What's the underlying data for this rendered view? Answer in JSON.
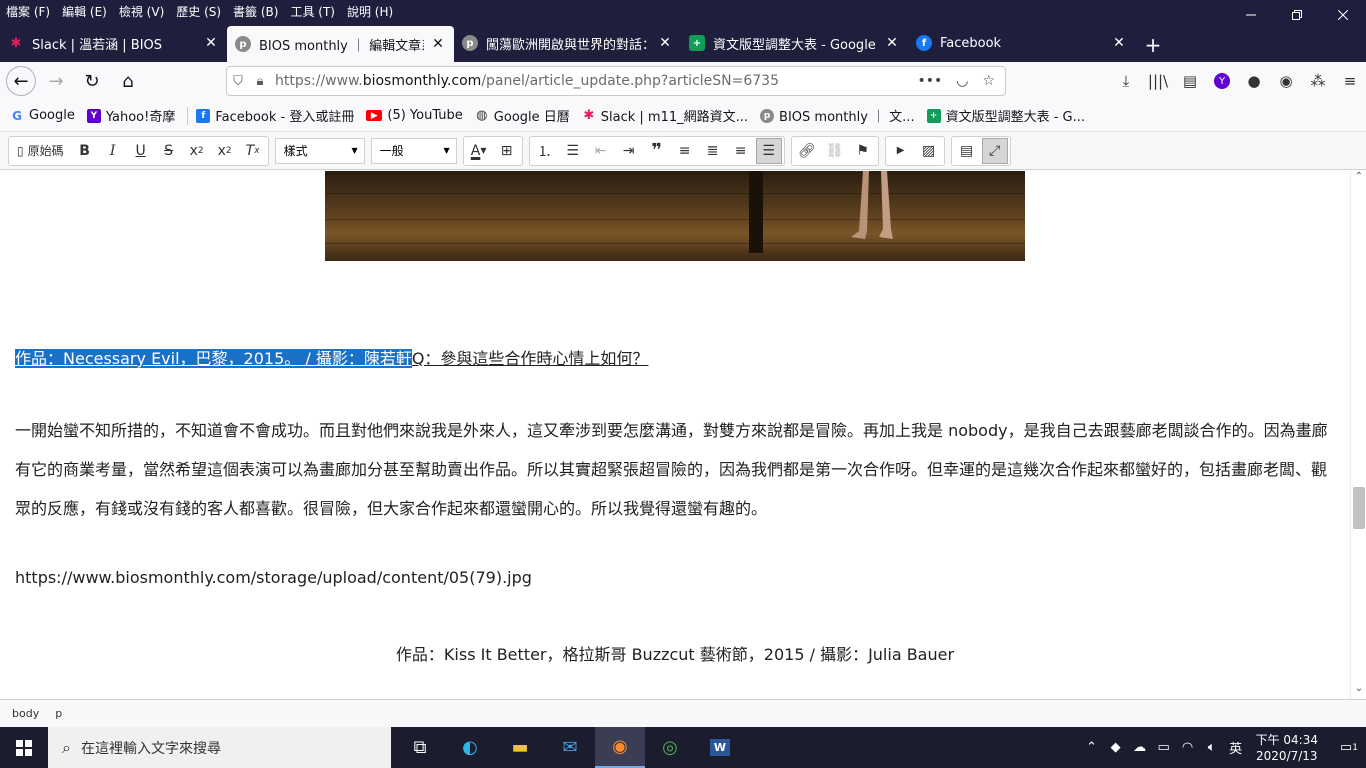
{
  "menu": [
    "檔案 (F)",
    "編輯 (E)",
    "檢視 (V)",
    "歷史 (S)",
    "書籤 (B)",
    "工具 (T)",
    "說明 (H)"
  ],
  "tabs": [
    {
      "label": "Slack | 溫若涵 | BIOS",
      "icon": "slack-icon",
      "active": false
    },
    {
      "label": "BIOS monthly ｜ 編輯文章系統",
      "icon": "bios-icon",
      "active": true
    },
    {
      "label": "闖蕩歐洲開啟與世界的對話：",
      "icon": "bios-icon",
      "active": false
    },
    {
      "label": "資文版型調整大表 - Google 試",
      "icon": "sheets-icon",
      "active": false
    },
    {
      "label": "Facebook",
      "icon": "facebook-icon",
      "active": false
    }
  ],
  "url": {
    "pre": "https://www.",
    "domain": "biosmonthly.com",
    "post": "/panel/article_update.php?articleSN=6735"
  },
  "bookmarks": [
    {
      "label": "Google",
      "icon": "google-icon"
    },
    {
      "label": "Yahoo!奇摩",
      "icon": "yahoo-icon"
    },
    {
      "label": "Facebook - 登入或註冊",
      "icon": "facebook-icon"
    },
    {
      "label": "(5) YouTube",
      "icon": "youtube-icon"
    },
    {
      "label": "Google 日曆",
      "icon": "globe-icon"
    },
    {
      "label": "Slack | m11_網路資文...",
      "icon": "slack-icon"
    },
    {
      "label": "BIOS monthly ｜ 文...",
      "icon": "bios-icon"
    },
    {
      "label": "資文版型調整大表 - G...",
      "icon": "sheets-icon"
    }
  ],
  "editor": {
    "source_label": "原始碼",
    "style_dropdown": "樣式",
    "format_dropdown": "一般"
  },
  "content": {
    "caption1_highlight": "作品：Necessary Evil，巴黎，2015。 / 攝影：陳若軒",
    "caption1_rest": "Q：參與這些合作時心情上如何？",
    "paragraph": "一開始蠻不知所措的，不知道會不會成功。而且對他們來說我是外來人，這又牽涉到要怎麼溝通，對雙方來說都是冒險。再加上我是 nobody，是我自己去跟藝廊老闆談合作的。因為畫廊有它的商業考量，當然希望這個表演可以為畫廊加分甚至幫助賣出作品。所以其實超緊張超冒險的，因為我們都是第一次合作呀。但幸運的是這幾次合作起來都蠻好的，包括畫廊老闆、觀眾的反應，有錢或沒有錢的客人都喜歡。很冒險，但大家合作起來都還蠻開心的。所以我覺得還蠻有趣的。",
    "image_url": "https://www.biosmonthly.com/storage/upload/content/05(79).jpg",
    "caption2": "作品：Kiss It Better，格拉斯哥 Buzzcut 藝術節，2015 / 攝影：Julia Bauer"
  },
  "status": {
    "path1": "body",
    "path2": "p"
  },
  "taskbar": {
    "search_placeholder": "在這裡輸入文字來搜尋",
    "ime": "英",
    "time": "下午 04:34",
    "date": "2020/7/13",
    "notification_count": "1"
  }
}
